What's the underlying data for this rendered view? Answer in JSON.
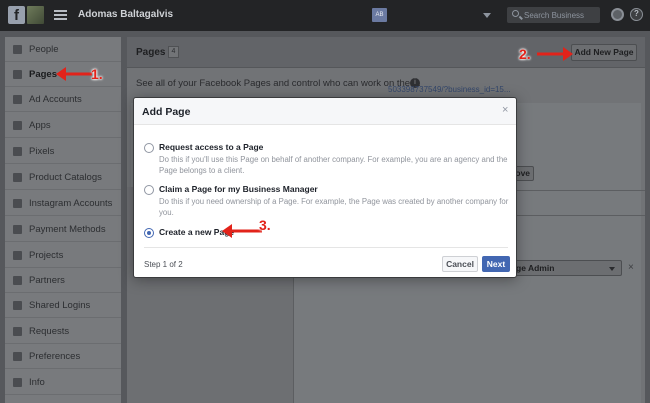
{
  "topbar": {
    "account_name": "Adomas Baltagalvis",
    "business_badge": "AB",
    "search_placeholder": "Search Business",
    "help_glyph": "?"
  },
  "sidebar": {
    "items": [
      {
        "label": "People",
        "icon": "person-icon"
      },
      {
        "label": "Pages",
        "icon": "flag-icon",
        "active": true
      },
      {
        "label": "Ad Accounts",
        "icon": "megaphone-icon"
      },
      {
        "label": "Apps",
        "icon": "cube-icon"
      },
      {
        "label": "Pixels",
        "icon": "pixel-icon"
      },
      {
        "label": "Product Catalogs",
        "icon": "grid-icon"
      },
      {
        "label": "Instagram Accounts",
        "icon": "instagram-icon"
      },
      {
        "label": "Payment Methods",
        "icon": "credit-card-icon"
      },
      {
        "label": "Projects",
        "icon": "folder-icon"
      },
      {
        "label": "Partners",
        "icon": "briefcase-icon"
      },
      {
        "label": "Shared Logins",
        "icon": "people-icon"
      },
      {
        "label": "Requests",
        "icon": "request-icon"
      },
      {
        "label": "Preferences",
        "icon": "list-icon"
      },
      {
        "label": "Info",
        "icon": "info-icon"
      }
    ]
  },
  "main": {
    "title": "Pages",
    "count": "4",
    "add_button": "Add New Page",
    "description": "See all of your Facebook Pages and control who can work on them.",
    "link_text": "503398737549/?business_id=15...",
    "remove_button": "Remove",
    "role_select": "ge Admin",
    "role_close": "×"
  },
  "modal": {
    "title": "Add Page",
    "close": "×",
    "options": [
      {
        "title": "Request access to a Page",
        "description": "Do this if you'll use this Page on behalf of another company. For example, you are an agency and the Page belongs to a client.",
        "checked": false
      },
      {
        "title": "Claim a Page for my Business Manager",
        "description": "Do this if you need ownership of a Page. For example, the Page was created by another company for you.",
        "checked": false
      },
      {
        "title": "Create a new Page",
        "description": "",
        "checked": true
      }
    ],
    "step": "Step 1 of 2",
    "cancel": "Cancel",
    "next": "Next"
  },
  "annotations": {
    "step1": "1.",
    "step2": "2.",
    "step3": "3."
  },
  "colors": {
    "annotation_red": "#e2231a",
    "primary_blue": "#4267b2"
  }
}
